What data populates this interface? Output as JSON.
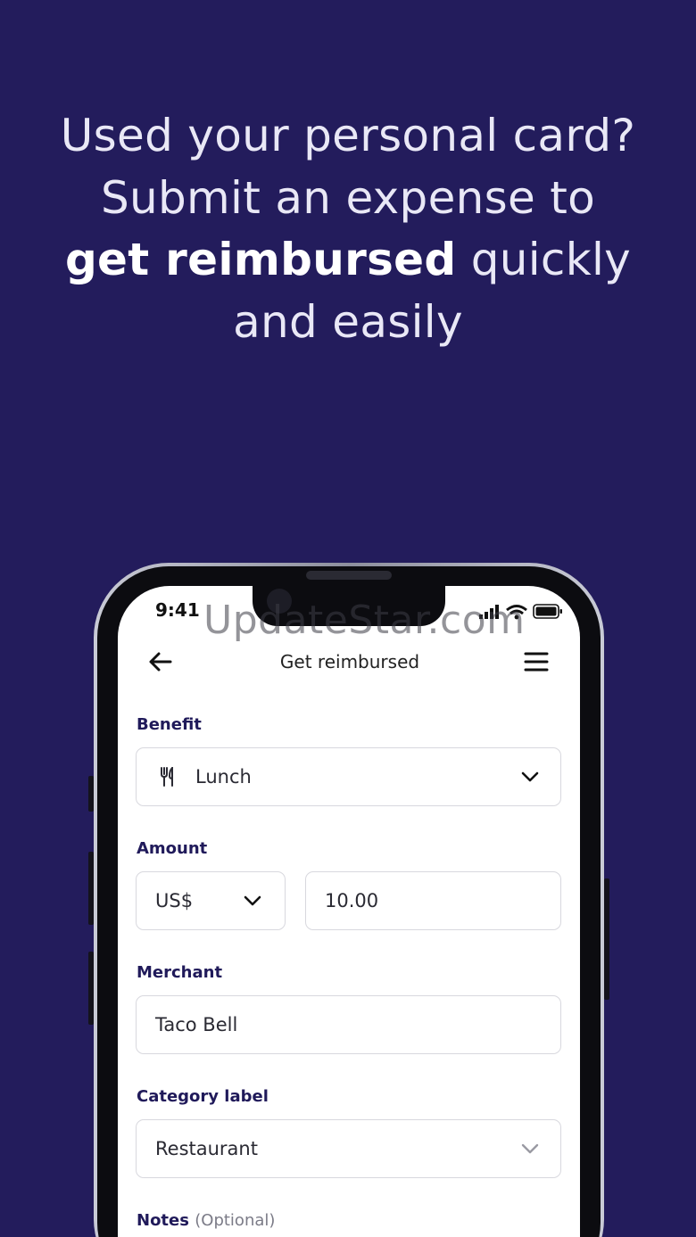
{
  "headline": {
    "part1": "Used your personal card? Submit an expense to",
    "bold1": "get reimbursed",
    "part2": "quickly and easily"
  },
  "status": {
    "time": "9:41"
  },
  "watermark": "UpdateStar.com",
  "nav": {
    "title": "Get reimbursed",
    "back_icon": "arrow-left-icon",
    "menu_icon": "hamburger-menu-icon"
  },
  "form": {
    "benefit": {
      "label": "Benefit",
      "value": "Lunch",
      "icon": "fork-knife-icon"
    },
    "amount": {
      "label": "Amount",
      "currency": "US$",
      "value": "10.00"
    },
    "merchant": {
      "label": "Merchant",
      "value": "Taco Bell"
    },
    "category": {
      "label": "Category label",
      "value": "Restaurant"
    },
    "notes": {
      "label": "Notes",
      "optional": "(Optional)"
    }
  },
  "colors": {
    "background": "#231c5c",
    "label": "#201a5a",
    "field_border": "#d8d8de"
  }
}
